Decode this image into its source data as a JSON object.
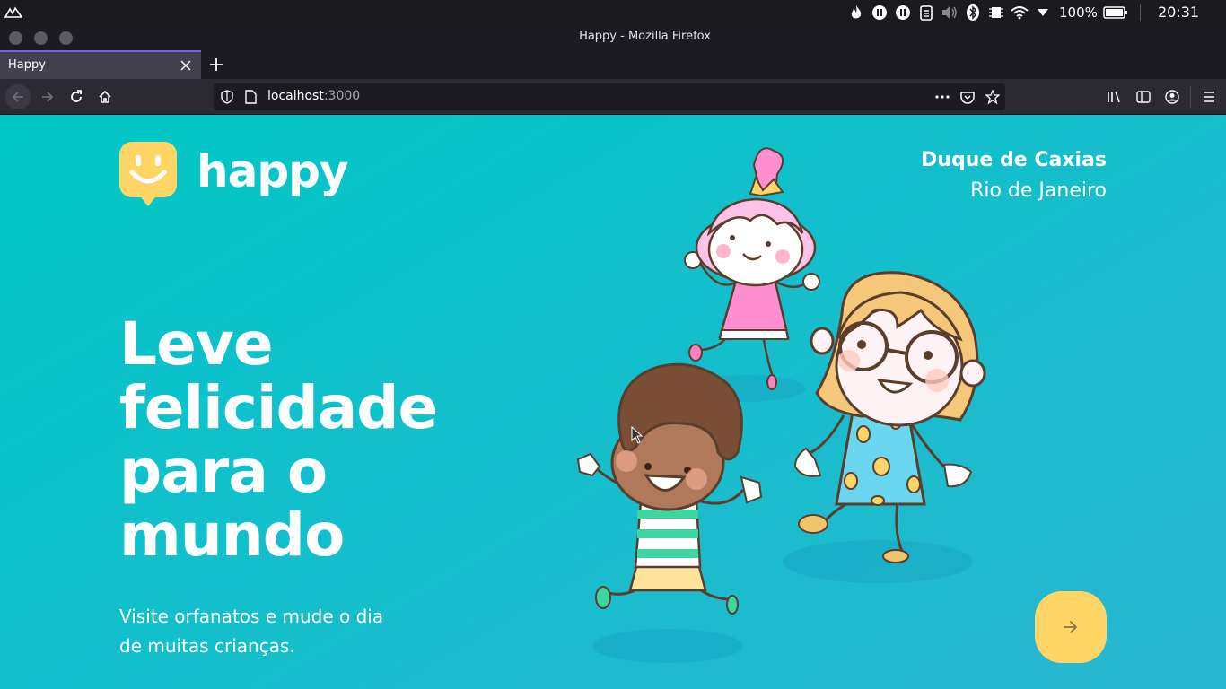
{
  "system_panel": {
    "battery": "100%",
    "clock": "20:31",
    "icons": [
      "distro-logo-icon",
      "flame-icon",
      "pause-icon",
      "pause-icon",
      "clipboard-icon",
      "volume-muted-icon",
      "bluetooth-icon",
      "memory-icon",
      "wifi-icon",
      "dropdown-triangle-icon",
      "battery-icon"
    ]
  },
  "window": {
    "title": "Happy - Mozilla Firefox"
  },
  "tabs": [
    {
      "label": "Happy",
      "active": true
    }
  ],
  "url": {
    "host": "localhost",
    "port": ":3000"
  },
  "page": {
    "logo_text": "happy",
    "location": {
      "city": "Duque de Caxias",
      "state": "Rio de Janeiro"
    },
    "headline": [
      "Leve",
      "felicidade",
      "para o",
      "mundo"
    ],
    "subheadline": [
      "Visite orfanatos e mude o dia",
      "de muitas crianças."
    ],
    "enter_button_icon": "arrow-right-icon"
  },
  "colors": {
    "gradient_start": "#29b6d1",
    "gradient_end": "#00c7c7",
    "logo_yellow": "#ffd666",
    "button_yellow": "#ffd666",
    "tab_accent": "#7b5ef0"
  }
}
